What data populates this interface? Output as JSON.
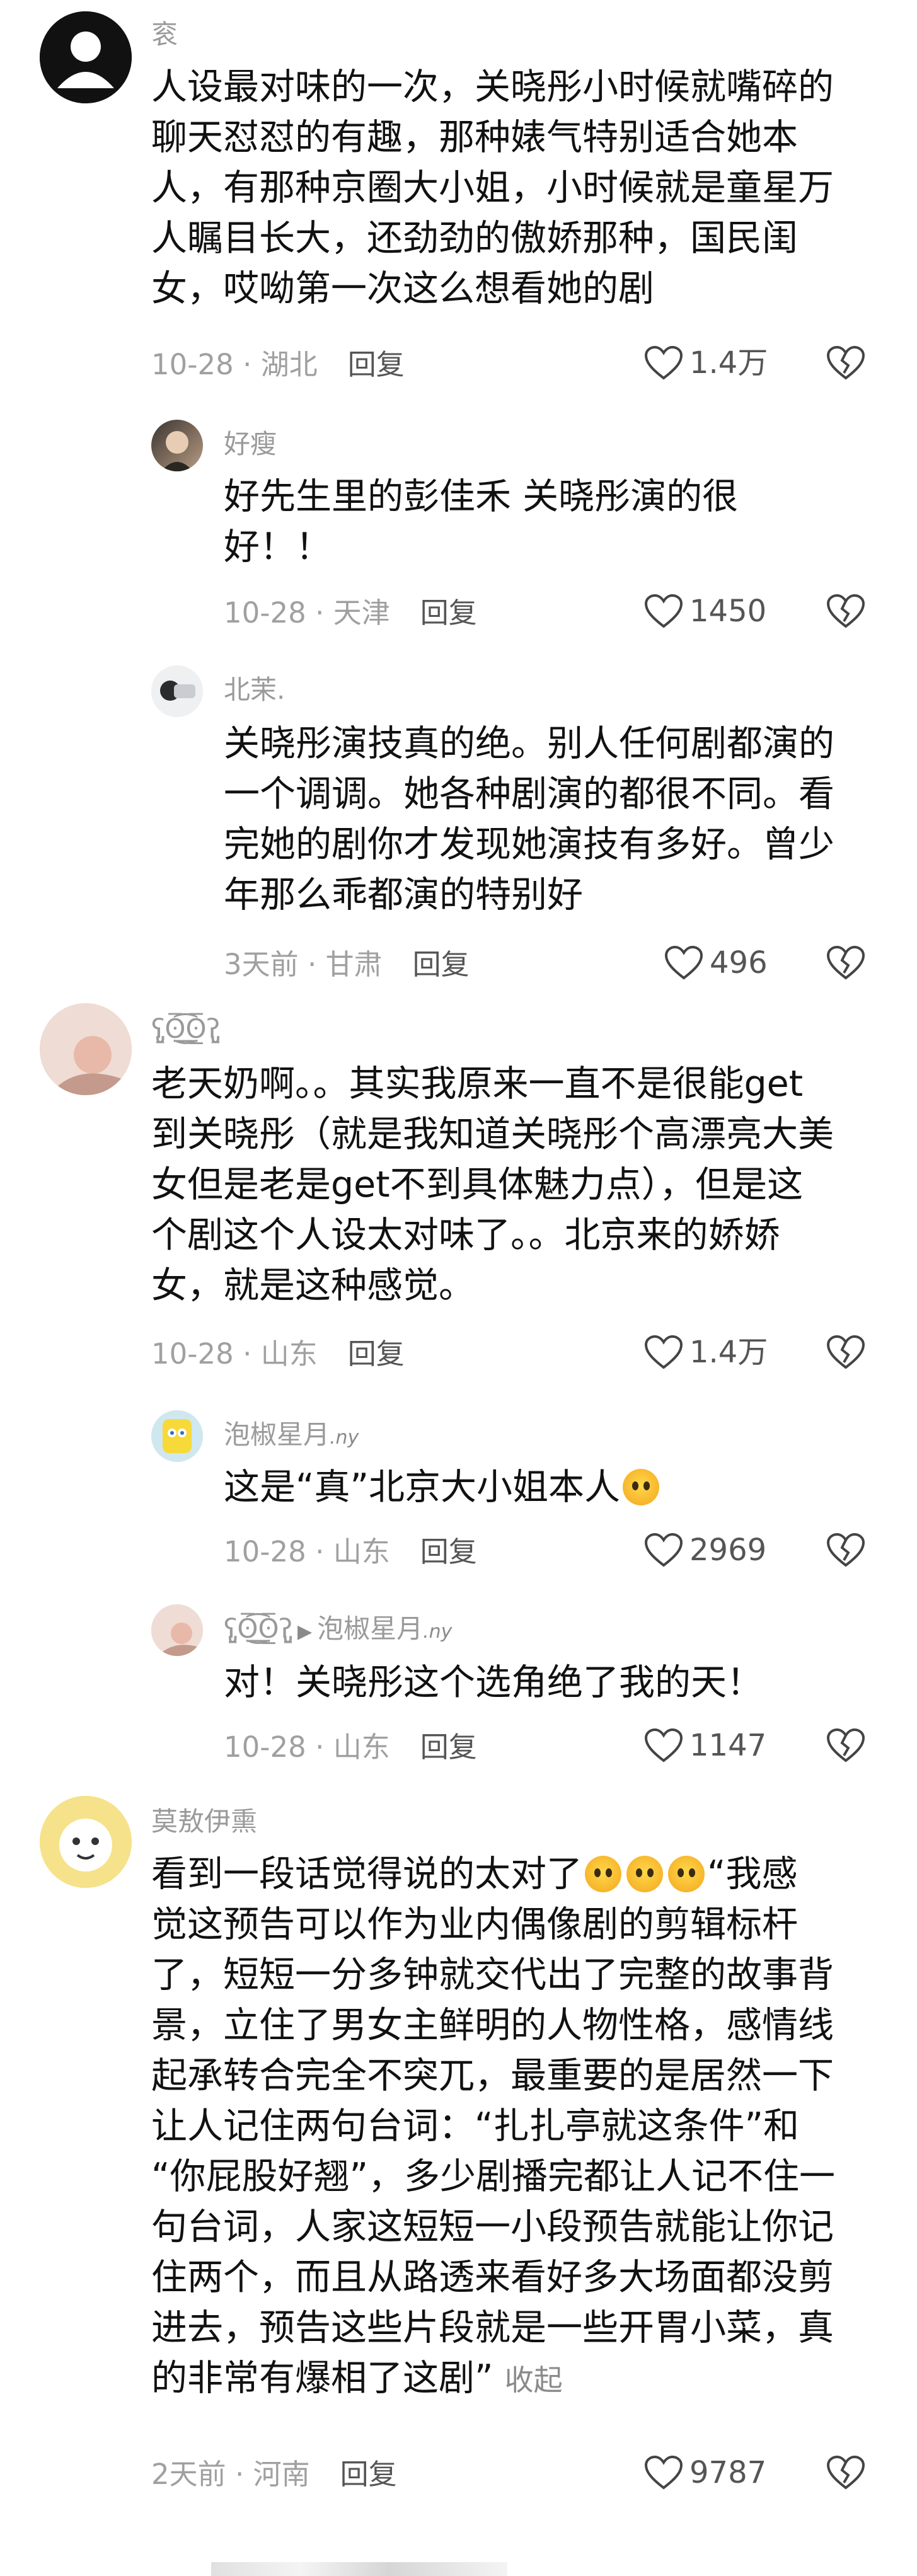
{
  "comments": [
    {
      "user": "衮",
      "lines": [
        "人设最对味的一次，关晓彤小时候就嘴碎的",
        "聊天怼怼的有趣，那种婊气特别适合她本",
        "人，有那种京圈大小姐，小时候就是童星万",
        "人瞩目长大，还劲劲的傲娇那种，国民闺",
        "女，哎呦第一次这么想看她的剧"
      ],
      "date": "10-28",
      "location": "湖北",
      "reply": "回复",
      "likes": "1.4万"
    },
    {
      "user": "好瘦",
      "lines": [
        "好先生里的彭佳禾  关晓彤演的很",
        "好！！"
      ],
      "date": "10-28",
      "location": "天津",
      "reply": "回复",
      "likes": "1450"
    },
    {
      "user": "北茉.",
      "lines": [
        "关晓彤演技真的绝。别人任何剧都演的",
        "一个调调。她各种剧演的都很不同。看",
        "完她的剧你才发现她演技有多好。曾少",
        "年那么乖都演的特别好"
      ],
      "date": "3天前",
      "location": "甘肃",
      "reply": "回复",
      "likes": "496"
    },
    {
      "user": "ʕ̡̢̡ʘ̅͟͜͡ʘ̲̅ʔ̢̡̢",
      "lines": [
        "老天奶啊。。其实我原来一直不是很能get",
        "到关晓彤（就是我知道关晓彤个高漂亮大美",
        "女但是老是get不到具体魅力点），但是这",
        "个剧这个人设太对味了。。北京来的娇娇",
        "女，就是这种感觉。"
      ],
      "date": "10-28",
      "location": "山东",
      "reply": "回复",
      "likes": "1.4万"
    },
    {
      "user": "泡椒星月",
      "user_suffix": ".ny",
      "line_pre": "这是“真”北京大小姐本人",
      "date": "10-28",
      "location": "山东",
      "reply": "回复",
      "likes": "2969"
    },
    {
      "user": "ʕ̡̢̡ʘ̅͟͜͡ʘ̲̅ʔ̢̡̢",
      "reply_to": "泡椒星月",
      "reply_to_suffix": ".ny",
      "lines": [
        "对！关晓彤这个选角绝了我的天！"
      ],
      "date": "10-28",
      "location": "山东",
      "reply": "回复",
      "likes": "1147"
    },
    {
      "user": "莫敖伊熏",
      "line0_pre": "看到一段话觉得说的太对了",
      "line0_post": "“我感",
      "lines": [
        "觉这预告可以作为业内偶像剧的剪辑标杆",
        "了，短短一分多钟就交代出了完整的故事背",
        "景，立住了男女主鲜明的人物性格，感情线",
        "起承转合完全不突兀，最重要的是居然一下",
        "让人记住两句台词：“扎扎亭就这条件”和",
        "“你屁股好翘”，多少剧播完都让人记不住一",
        "句台词，人家这短短一小段预告就能让你记",
        "住两个，而且从路透来看好多大场面都没剪",
        "进去，预告这些片段就是一些开胃小菜，真"
      ],
      "last_line": "的非常有爆相了这剧”",
      "collapse": "收起",
      "date": "2天前",
      "location": "河南",
      "reply": "回复",
      "likes": "9787"
    }
  ]
}
